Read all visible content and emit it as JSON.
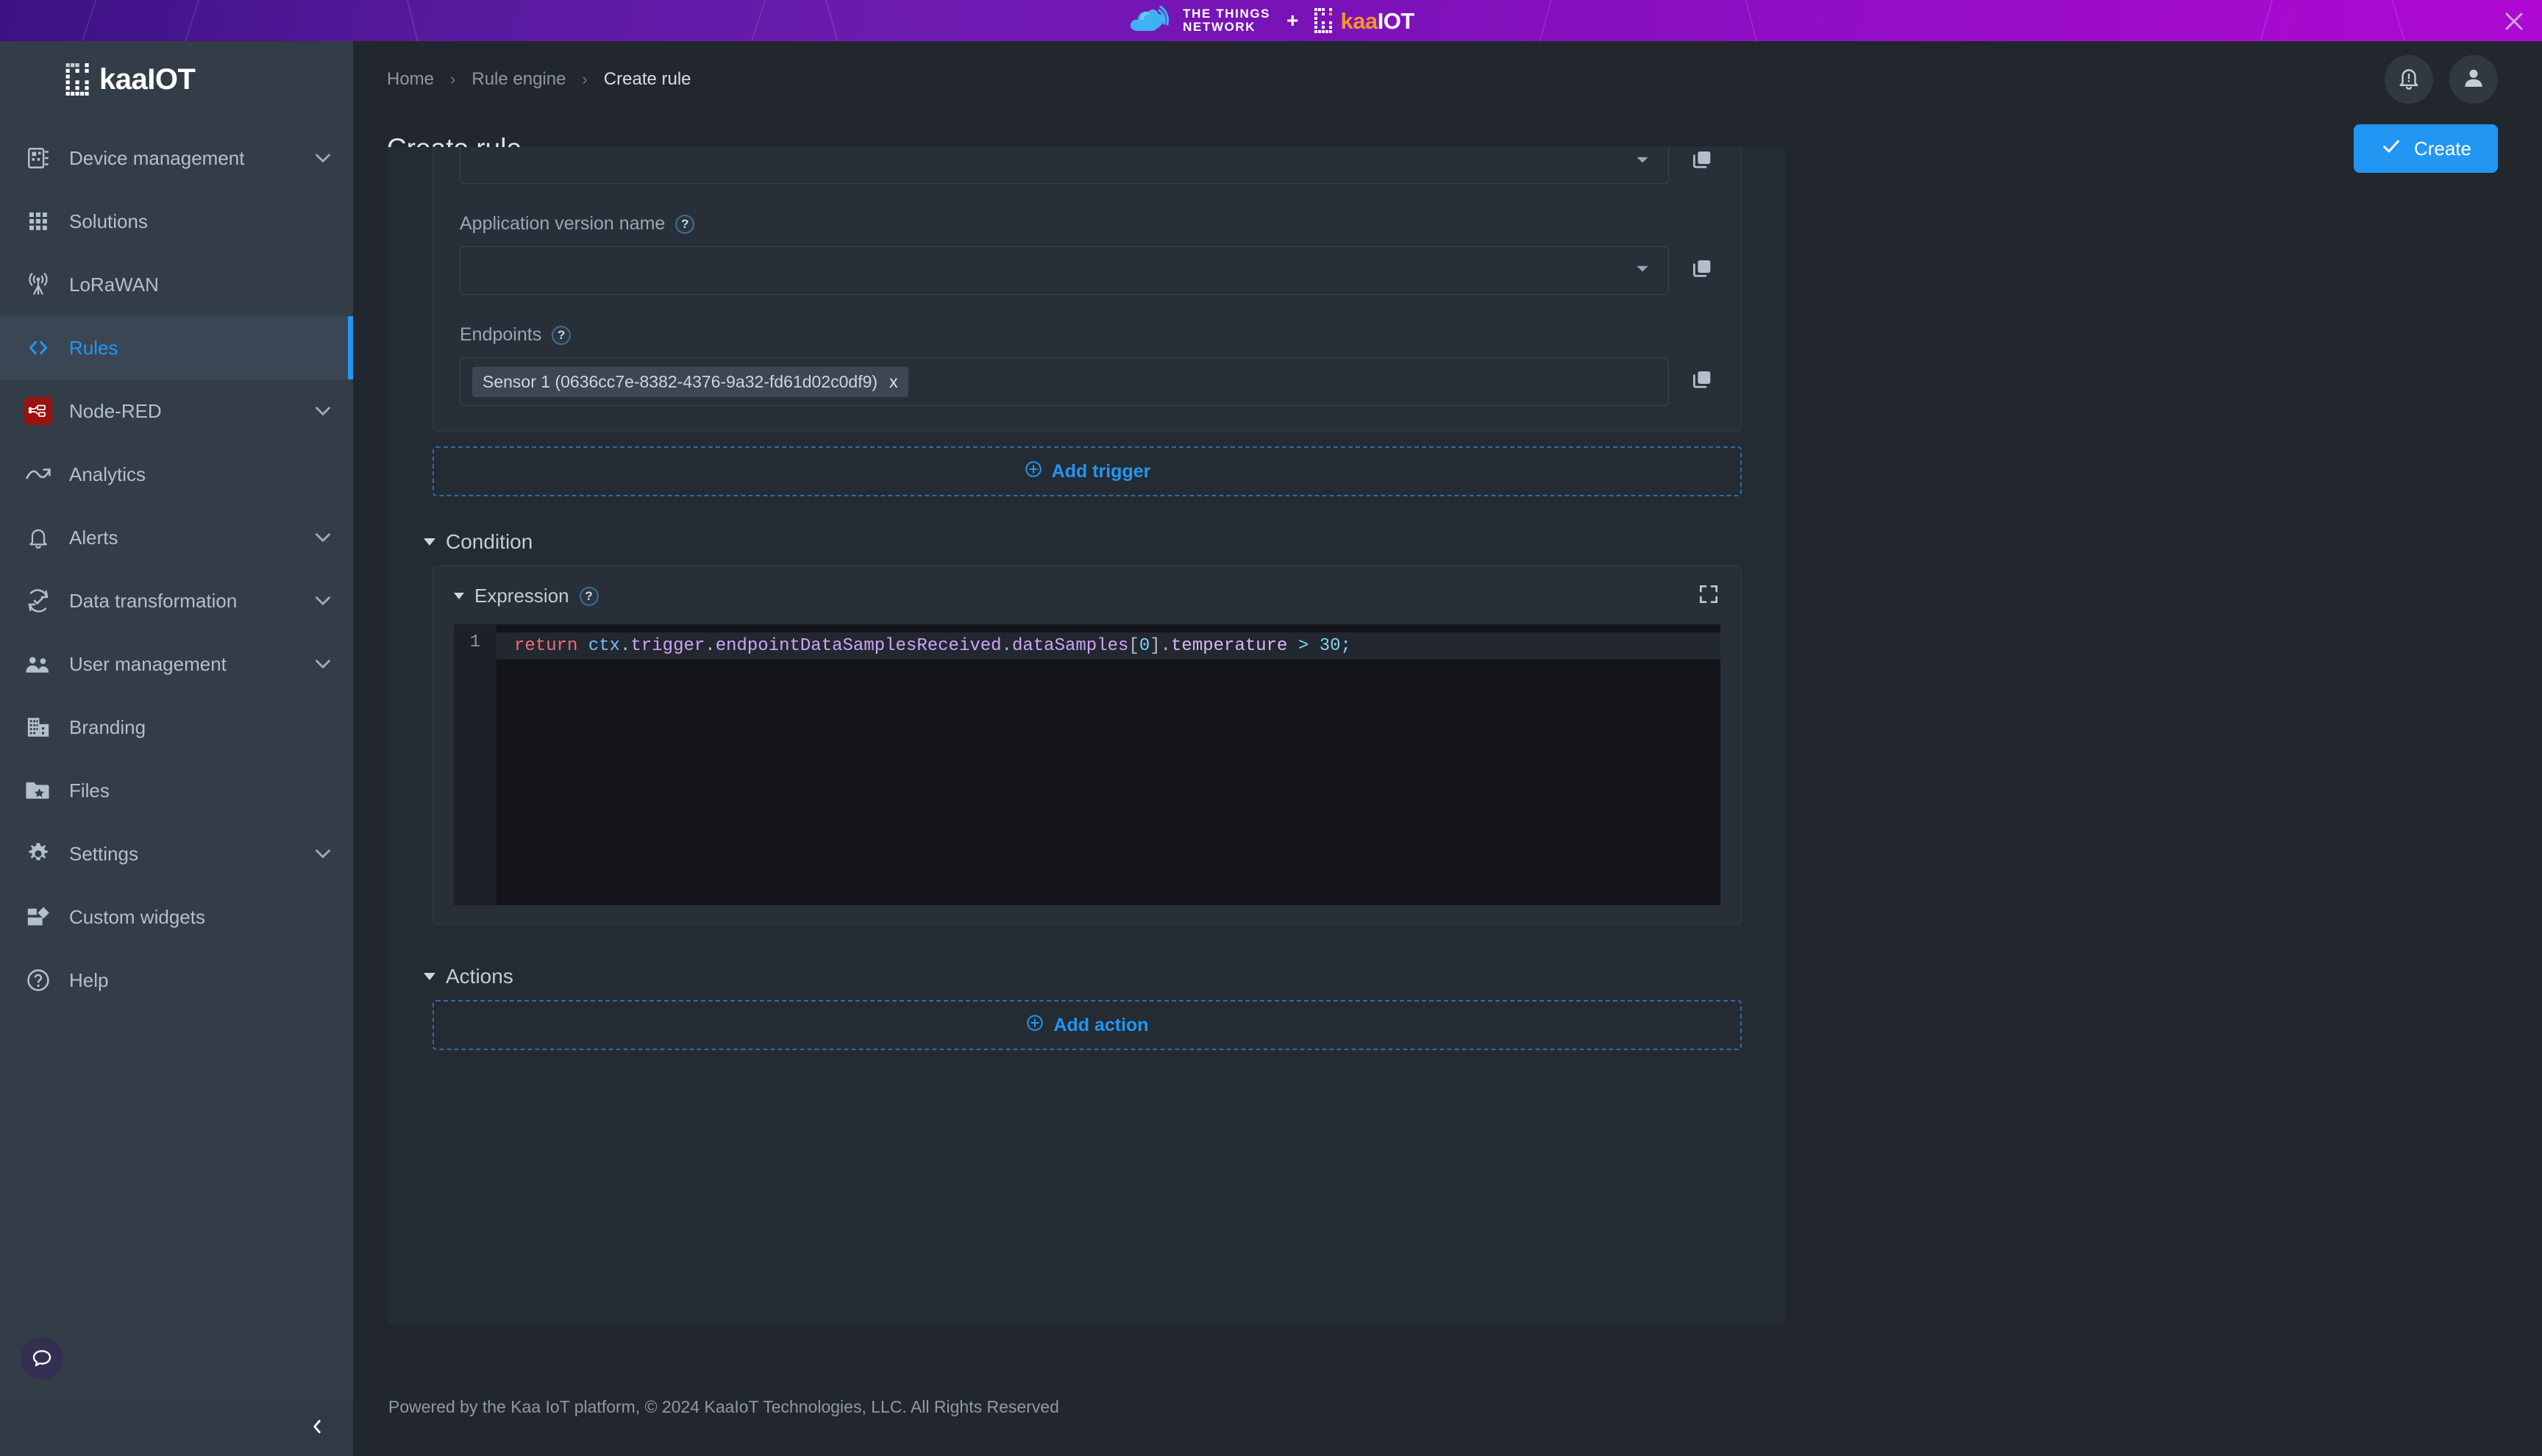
{
  "promo_banner": {
    "ttn_line1": "THE THINGS",
    "ttn_line2": "NETWORK",
    "plus": "+",
    "kaa_k": "kaa",
    "kaa_iot": "IOT",
    "close_icon": "close-icon",
    "gradient_from": "#3b1183",
    "gradient_to": "#ae09d2"
  },
  "sidebar": {
    "logo_text": "kaaIOT",
    "items": [
      {
        "label": "Device management",
        "icon": "device-management-icon",
        "chevron": true,
        "active": false
      },
      {
        "label": "Solutions",
        "icon": "solutions-grid-icon",
        "chevron": false,
        "active": false
      },
      {
        "label": "LoRaWAN",
        "icon": "lorawan-antenna-icon",
        "chevron": false,
        "active": false
      },
      {
        "label": "Rules",
        "icon": "code-brackets-icon",
        "chevron": false,
        "active": true
      },
      {
        "label": "Node-RED",
        "icon": "node-red-icon",
        "chevron": true,
        "active": false
      },
      {
        "label": "Analytics",
        "icon": "analytics-chart-icon",
        "chevron": false,
        "active": false
      },
      {
        "label": "Alerts",
        "icon": "bell-icon",
        "chevron": true,
        "active": false
      },
      {
        "label": "Data transformation",
        "icon": "data-transform-icon",
        "chevron": true,
        "active": false
      },
      {
        "label": "User management",
        "icon": "users-icon",
        "chevron": true,
        "active": false
      },
      {
        "label": "Branding",
        "icon": "building-icon",
        "chevron": false,
        "active": false
      },
      {
        "label": "Files",
        "icon": "folder-star-icon",
        "chevron": false,
        "active": false
      },
      {
        "label": "Settings",
        "icon": "gear-icon",
        "chevron": true,
        "active": false
      },
      {
        "label": "Custom widgets",
        "icon": "widgets-icon",
        "chevron": false,
        "active": false
      },
      {
        "label": "Help",
        "icon": "help-circle-icon",
        "chevron": false,
        "active": false
      }
    ],
    "chat_icon": "chat-bubble-icon",
    "collapse_icon": "chevron-left-icon",
    "accent_color": "#2196f3"
  },
  "topbar": {
    "breadcrumb": [
      {
        "label": "Home"
      },
      {
        "label": "Rule engine"
      },
      {
        "label": "Create rule"
      }
    ],
    "separator": "›",
    "notifications_icon": "bell-alert-icon",
    "account_icon": "user-avatar-icon"
  },
  "page": {
    "title": "Create rule",
    "create_label": "Create",
    "create_icon": "check-icon",
    "create_color": "#2196f3"
  },
  "trigger_form": {
    "fields": [
      {
        "label": "",
        "help": "",
        "type": "select",
        "value": "",
        "placeholder": "",
        "copy_icon": "copy-icon",
        "partial": true
      },
      {
        "label": "Application version name",
        "help": "?",
        "type": "select",
        "value": "",
        "placeholder": "",
        "copy_icon": "copy-icon",
        "partial": false
      }
    ],
    "endpoints": {
      "label": "Endpoints",
      "help": "?",
      "copy_icon": "copy-icon",
      "chips": [
        {
          "text": "Sensor 1 (0636cc7e-8382-4376-9a32-fd61d02c0df9)",
          "remove": "x"
        }
      ]
    },
    "add_trigger": {
      "label": "Add trigger",
      "icon": "plus-circle-icon"
    }
  },
  "condition": {
    "heading": "Condition",
    "expression": {
      "heading": "Expression",
      "help": "?",
      "expand_icon": "fullscreen-expand-icon",
      "line_number": "1",
      "code_tokens": [
        {
          "t": "return ",
          "c": "tok-kw"
        },
        {
          "t": "ctx",
          "c": "tok-root"
        },
        {
          "t": ".",
          "c": "tok-punc"
        },
        {
          "t": "trigger",
          "c": "tok-id"
        },
        {
          "t": ".",
          "c": "tok-punc"
        },
        {
          "t": "endpointDataSamplesReceived",
          "c": "tok-id"
        },
        {
          "t": ".",
          "c": "tok-punc"
        },
        {
          "t": "dataSamples",
          "c": "tok-id"
        },
        {
          "t": "[",
          "c": "tok-punc"
        },
        {
          "t": "0",
          "c": "tok-num"
        },
        {
          "t": "]",
          "c": "tok-punc"
        },
        {
          "t": ".",
          "c": "tok-punc"
        },
        {
          "t": "temperature",
          "c": "tok-prop"
        },
        {
          "t": " > ",
          "c": "tok-op"
        },
        {
          "t": "30",
          "c": "tok-num"
        },
        {
          "t": ";",
          "c": "tok-op"
        }
      ],
      "code_plain": "return ctx.trigger.endpointDataSamplesReceived.dataSamples[0].temperature > 30;"
    }
  },
  "actions": {
    "heading": "Actions",
    "add_action": {
      "label": "Add action",
      "icon": "plus-circle-icon"
    }
  },
  "footer": {
    "text": "Powered by the Kaa IoT platform, © 2024 KaaIoT Technologies, LLC. All Rights Reserved"
  }
}
